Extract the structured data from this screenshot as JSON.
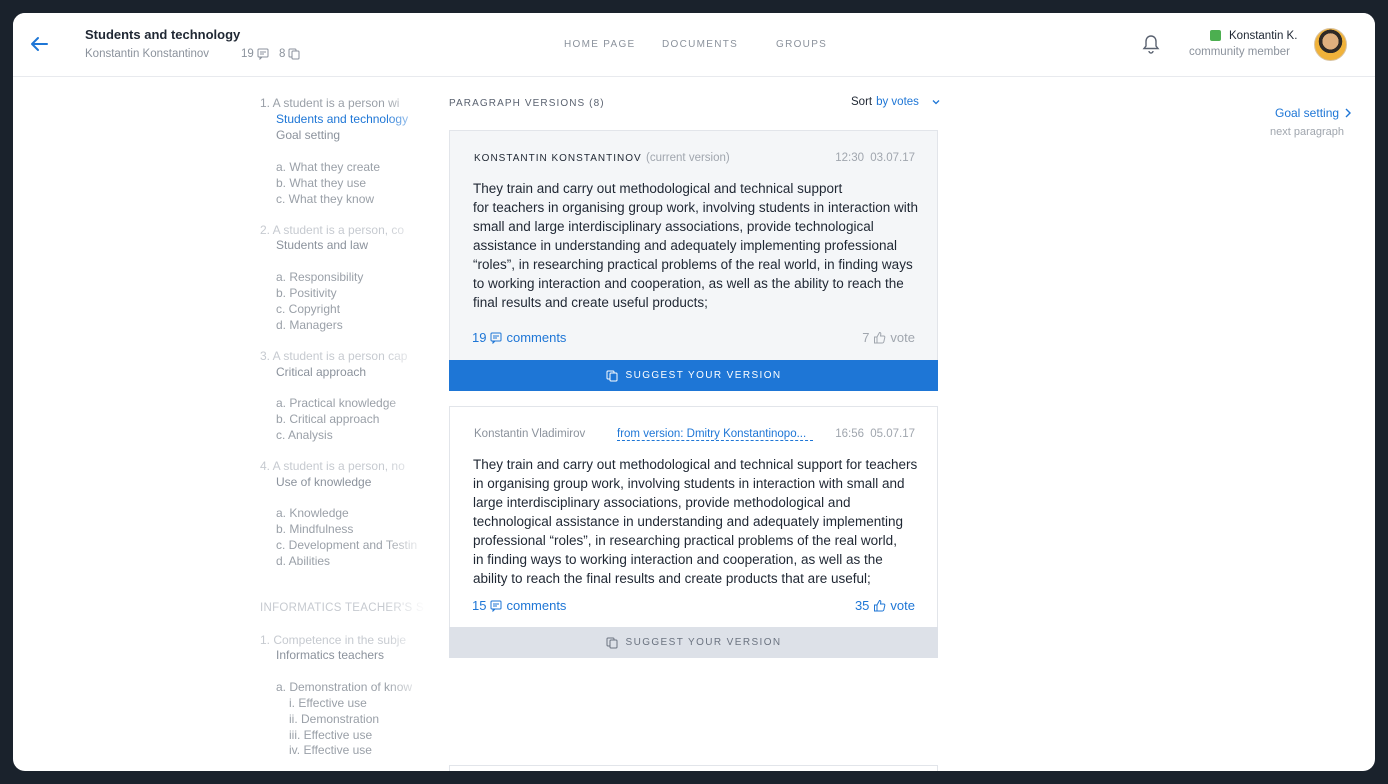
{
  "header": {
    "title": "Students and technology",
    "author": "Konstantin Konstantinov",
    "comments_count": "19",
    "copies_count": "8",
    "nav": [
      "HOME PAGE",
      "DOCUMENTS",
      "GROUPS"
    ],
    "user_name": "Konstantin K.",
    "user_role": "community member"
  },
  "outline": [
    {
      "text": "1.  A student is a person wi",
      "cls": "o-q"
    },
    {
      "text": "Students and technology",
      "cls": "o-active"
    },
    {
      "text": "Goal setting",
      "cls": "o-h"
    },
    {
      "text": "a. What they create",
      "cls": ""
    },
    {
      "text": "b. What they use",
      "cls": ""
    },
    {
      "text": "c. What they know",
      "cls": ""
    },
    {
      "text": "2.  A student is a person, co",
      "cls": "o-q"
    },
    {
      "text": "Students and law",
      "cls": "o-h"
    },
    {
      "text": "a. Responsibility",
      "cls": ""
    },
    {
      "text": "b. Positivity",
      "cls": ""
    },
    {
      "text": "c. Copyright",
      "cls": ""
    },
    {
      "text": "d. Managers",
      "cls": ""
    },
    {
      "text": "3.  A student is a person cap",
      "cls": "o-q"
    },
    {
      "text": "Critical approach",
      "cls": "o-h"
    },
    {
      "text": "a. Practical knowledge",
      "cls": ""
    },
    {
      "text": "b. Critical approach",
      "cls": ""
    },
    {
      "text": "c. Analysis",
      "cls": ""
    },
    {
      "text": "4.  A student is a person, no",
      "cls": "o-q"
    },
    {
      "text": "Use of knowledge",
      "cls": "o-h"
    },
    {
      "text": "a. Knowledge",
      "cls": ""
    },
    {
      "text": "b. Mindfulness",
      "cls": ""
    },
    {
      "text": "c. Development and Testin",
      "cls": ""
    },
    {
      "text": "d. Abilities",
      "cls": ""
    },
    {
      "text": "INFORMATICS TEACHER'S S",
      "cls": "o-sec"
    },
    {
      "text": "1.  Competence in the subje",
      "cls": "o-q"
    },
    {
      "text": "Informatics teachers",
      "cls": "o-h"
    },
    {
      "text": "a. Demonstration of know",
      "cls": ""
    },
    {
      "text": "i.   Effective use",
      "cls": ""
    },
    {
      "text": "ii.  Demonstration",
      "cls": ""
    },
    {
      "text": "iii. Effective use",
      "cls": ""
    },
    {
      "text": "iv. Effective use",
      "cls": ""
    }
  ],
  "versions": {
    "title": "PARAGRAPH VERSIONS (8)",
    "sort_label": "Sort",
    "sort_value": "by votes",
    "cards": [
      {
        "author": "KONSTANTIN KONSTANTINOV",
        "note": "(current version)",
        "time": "12:30  03.07.17",
        "text": "They train and carry out methodological and technical support\nfor teachers in organising group work, involving students in interaction with small and large interdisciplinary associations, provide technological assistance in understanding and adequately implementing professional “roles”, in researching practical problems of the real world, in finding ways to working interaction and cooperation, as well as the ability to reach the final results and create useful products;",
        "comments_count": "19",
        "comments_label": "comments",
        "votes": "7",
        "vote_label": "vote",
        "suggest": "SUGGEST YOUR VERSION"
      },
      {
        "author": "Konstantin Vladimirov",
        "link": "from version: Dmitry Konstantinopo...",
        "time": "16:56  05.07.17",
        "text": "They train and carry out methodological and technical support for teachers in organising group work, involving students in interaction with small and large interdisciplinary associations, provide methodological and technological assistance in understanding and adequately implementing professional “roles”, in researching practical problems of the real world,\nin finding ways to working interaction and cooperation, as well as the ability to reach the final results and create products that are useful;",
        "comments_count": "15",
        "comments_label": "comments",
        "votes": "35",
        "vote_label": "vote",
        "suggest": "SUGGEST YOUR VERSION"
      }
    ]
  },
  "next": {
    "label": "Goal setting",
    "sub": "next paragraph"
  }
}
